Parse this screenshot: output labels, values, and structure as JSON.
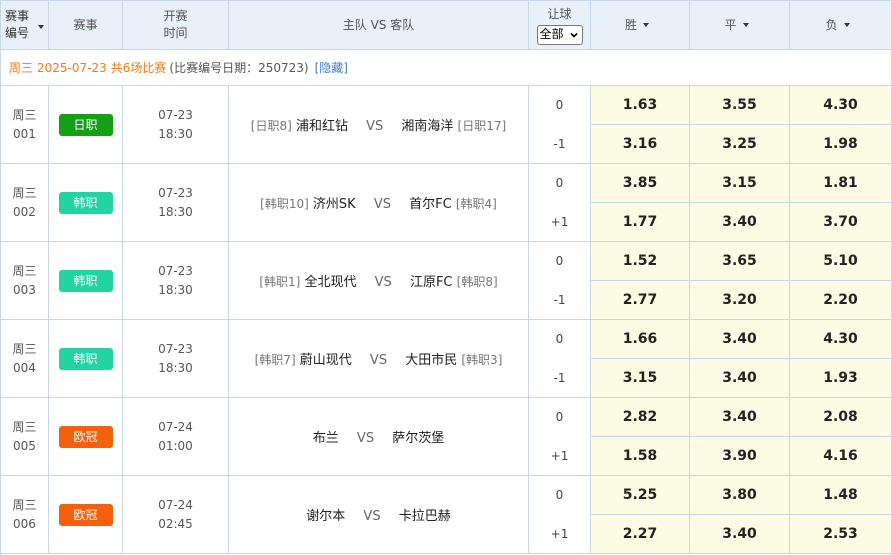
{
  "header": {
    "col1_line1": "赛事",
    "col1_line2": "编号",
    "col2": "赛事",
    "col3_line1": "开赛",
    "col3_line2": "时间",
    "col4": "主队 VS 客队",
    "col5": "让球",
    "handicap_filter": "全部",
    "win": "胜",
    "draw": "平",
    "lose": "负"
  },
  "info": {
    "day": "周三",
    "date": "2025-07-23",
    "summary": "共6场比赛",
    "sub": "(比赛编号日期：250723)",
    "hide": "[隐藏]"
  },
  "colors": {
    "日职": "#14a014",
    "韩职": "#22d3a3",
    "欧冠": "#f5600f"
  },
  "matches": [
    {
      "day": "周三",
      "no": "001",
      "league": "日职",
      "date": "07-23",
      "time": "18:30",
      "home_rank": "[日职8]",
      "home": "浦和红钻",
      "vs": "VS",
      "away": "湘南海洋",
      "away_rank": "[日职17]",
      "hc1": "0",
      "hc2": "-1",
      "odds1": [
        "1.63",
        "3.55",
        "4.30"
      ],
      "odds2": [
        "3.16",
        "3.25",
        "1.98"
      ]
    },
    {
      "day": "周三",
      "no": "002",
      "league": "韩职",
      "date": "07-23",
      "time": "18:30",
      "home_rank": "[韩职10]",
      "home": "济州SK",
      "vs": "VS",
      "away": "首尔FC",
      "away_rank": "[韩职4]",
      "hc1": "0",
      "hc2": "+1",
      "odds1": [
        "3.85",
        "3.15",
        "1.81"
      ],
      "odds2": [
        "1.77",
        "3.40",
        "3.70"
      ]
    },
    {
      "day": "周三",
      "no": "003",
      "league": "韩职",
      "date": "07-23",
      "time": "18:30",
      "home_rank": "[韩职1]",
      "home": "全北现代",
      "vs": "VS",
      "away": "江原FC",
      "away_rank": "[韩职8]",
      "hc1": "0",
      "hc2": "-1",
      "odds1": [
        "1.52",
        "3.65",
        "5.10"
      ],
      "odds2": [
        "2.77",
        "3.20",
        "2.20"
      ]
    },
    {
      "day": "周三",
      "no": "004",
      "league": "韩职",
      "date": "07-23",
      "time": "18:30",
      "home_rank": "[韩职7]",
      "home": "蔚山现代",
      "vs": "VS",
      "away": "大田市民",
      "away_rank": "[韩职3]",
      "hc1": "0",
      "hc2": "-1",
      "odds1": [
        "1.66",
        "3.40",
        "4.30"
      ],
      "odds2": [
        "3.15",
        "3.40",
        "1.93"
      ]
    },
    {
      "day": "周三",
      "no": "005",
      "league": "欧冠",
      "date": "07-24",
      "time": "01:00",
      "home_rank": "",
      "home": "布兰",
      "vs": "VS",
      "away": "萨尔茨堡",
      "away_rank": "",
      "hc1": "0",
      "hc2": "+1",
      "odds1": [
        "2.82",
        "3.40",
        "2.08"
      ],
      "odds2": [
        "1.58",
        "3.90",
        "4.16"
      ]
    },
    {
      "day": "周三",
      "no": "006",
      "league": "欧冠",
      "date": "07-24",
      "time": "02:45",
      "home_rank": "",
      "home": "谢尔本",
      "vs": "VS",
      "away": "卡拉巴赫",
      "away_rank": "",
      "hc1": "0",
      "hc2": "+1",
      "odds1": [
        "5.25",
        "3.80",
        "1.48"
      ],
      "odds2": [
        "2.27",
        "3.40",
        "2.53"
      ]
    }
  ]
}
